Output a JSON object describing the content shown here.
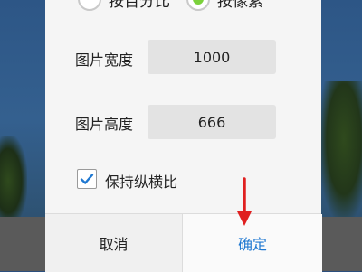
{
  "dialog": {
    "unit_options": [
      {
        "label": "按百分比",
        "selected": false
      },
      {
        "label": "按像素",
        "selected": true
      }
    ],
    "width_label": "图片宽度",
    "width_value": "1000",
    "height_label": "图片高度",
    "height_value": "666",
    "keep_ratio_label": "保持纵横比",
    "keep_ratio_checked": true,
    "cancel_label": "取消",
    "ok_label": "确定"
  },
  "colors": {
    "accent": "#1f78d1",
    "radio_selected": "#7bd13b",
    "annotation_arrow": "#e02020"
  }
}
